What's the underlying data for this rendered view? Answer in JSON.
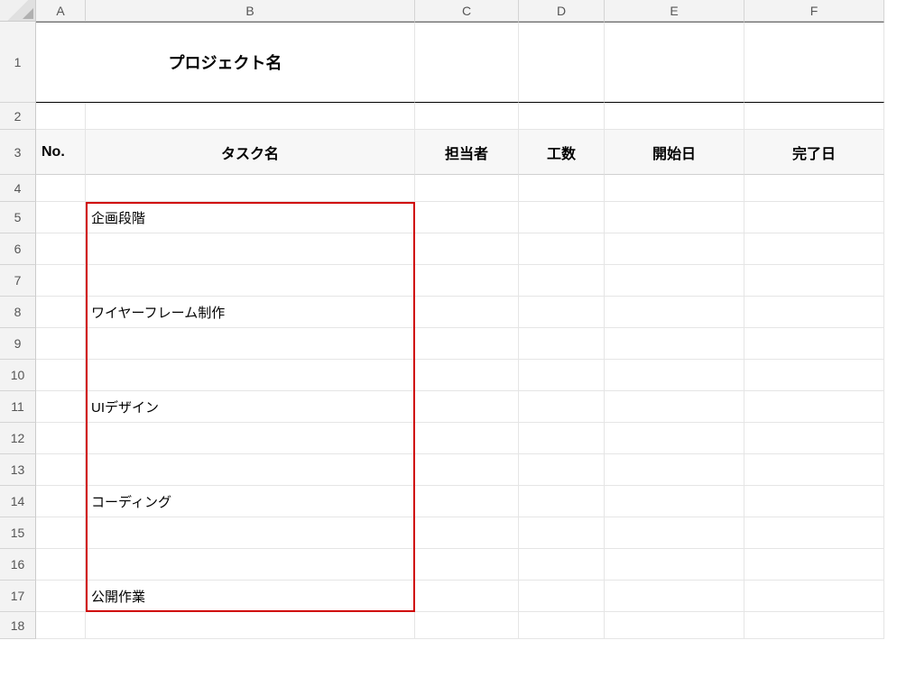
{
  "columns": [
    "A",
    "B",
    "C",
    "D",
    "E",
    "F"
  ],
  "row_numbers": [
    1,
    2,
    3,
    4,
    5,
    6,
    7,
    8,
    9,
    10,
    11,
    12,
    13,
    14,
    15,
    16,
    17,
    18
  ],
  "row1": {
    "project_label": "プロジェクト名"
  },
  "row3_headers": {
    "no": "No.",
    "task_name": "タスク名",
    "assignee": "担当者",
    "effort": "工数",
    "start_date": "開始日",
    "end_date": "完了日"
  },
  "tasks": {
    "b5": "企画段階",
    "b8": "ワイヤーフレーム制作",
    "b11": "UIデザイン",
    "b14": "コーディング",
    "b17": "公開作業"
  },
  "selection": {
    "range": "B5:B17"
  }
}
